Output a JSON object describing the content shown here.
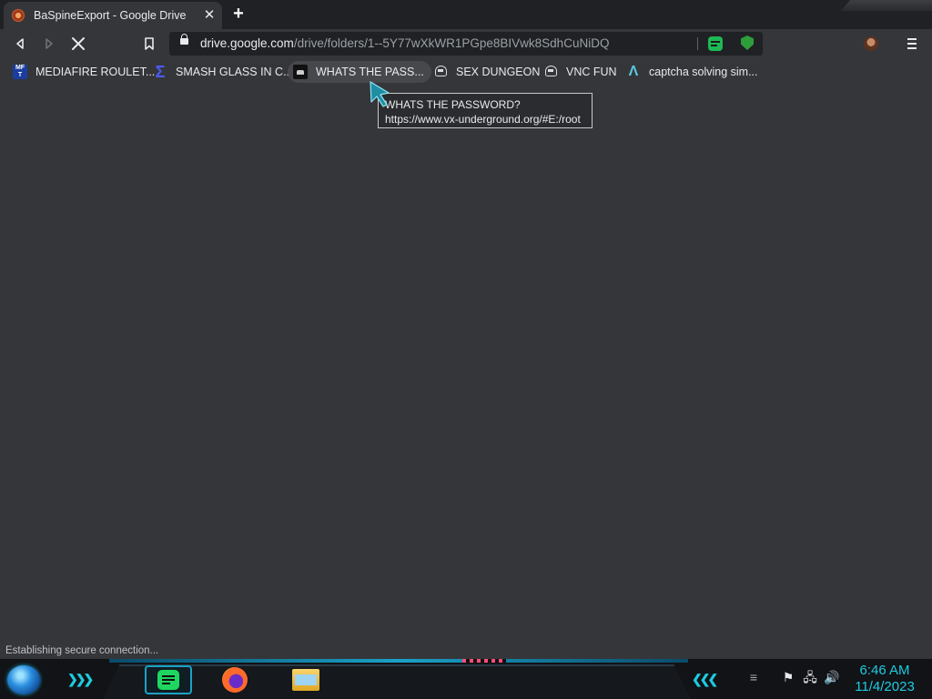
{
  "tab": {
    "title": "BaSpineExport - Google Drive",
    "close_glyph": "✕",
    "new_tab_glyph": "+"
  },
  "toolbar": {
    "url_host": "drive.google.com",
    "url_path": "/drive/folders/1--5Y77wXkWR1PGpe8BIVwk8SdhCuNiDQ",
    "icons": [
      "back-icon",
      "forward-icon",
      "stop-icon",
      "bookmark-icon",
      "lock-icon",
      "extension-sheets-icon",
      "extension-shield-icon",
      "profile-avatar",
      "menu-icon"
    ]
  },
  "bookmarks": [
    {
      "label": "MEDIAFIRE ROULET...",
      "icon": "mediafire-icon",
      "icon_text": "MF\nT"
    },
    {
      "label": "SMASH GLASS IN C...",
      "icon": "sigma-icon",
      "icon_text": "Σ"
    },
    {
      "label": "WHATS THE PASS...",
      "icon": "terminal-icon",
      "icon_text": ""
    },
    {
      "label": "SEX DUNGEON",
      "icon": "robot-icon",
      "icon_text": ""
    },
    {
      "label": "VNC FUN",
      "icon": "robot-icon",
      "icon_text": ""
    },
    {
      "label": "captcha solving sim...",
      "icon": "lambda-icon",
      "icon_text": "Λ"
    }
  ],
  "tooltip": {
    "title": "WHATS THE PASSWORD?",
    "url": "https://www.vx-underground.org/#E:/root"
  },
  "status": {
    "text": "Establishing secure connection..."
  },
  "taskbar": {
    "time": "6:46 AM",
    "date": "11/4/2023",
    "accent": "#1ecbe1"
  }
}
